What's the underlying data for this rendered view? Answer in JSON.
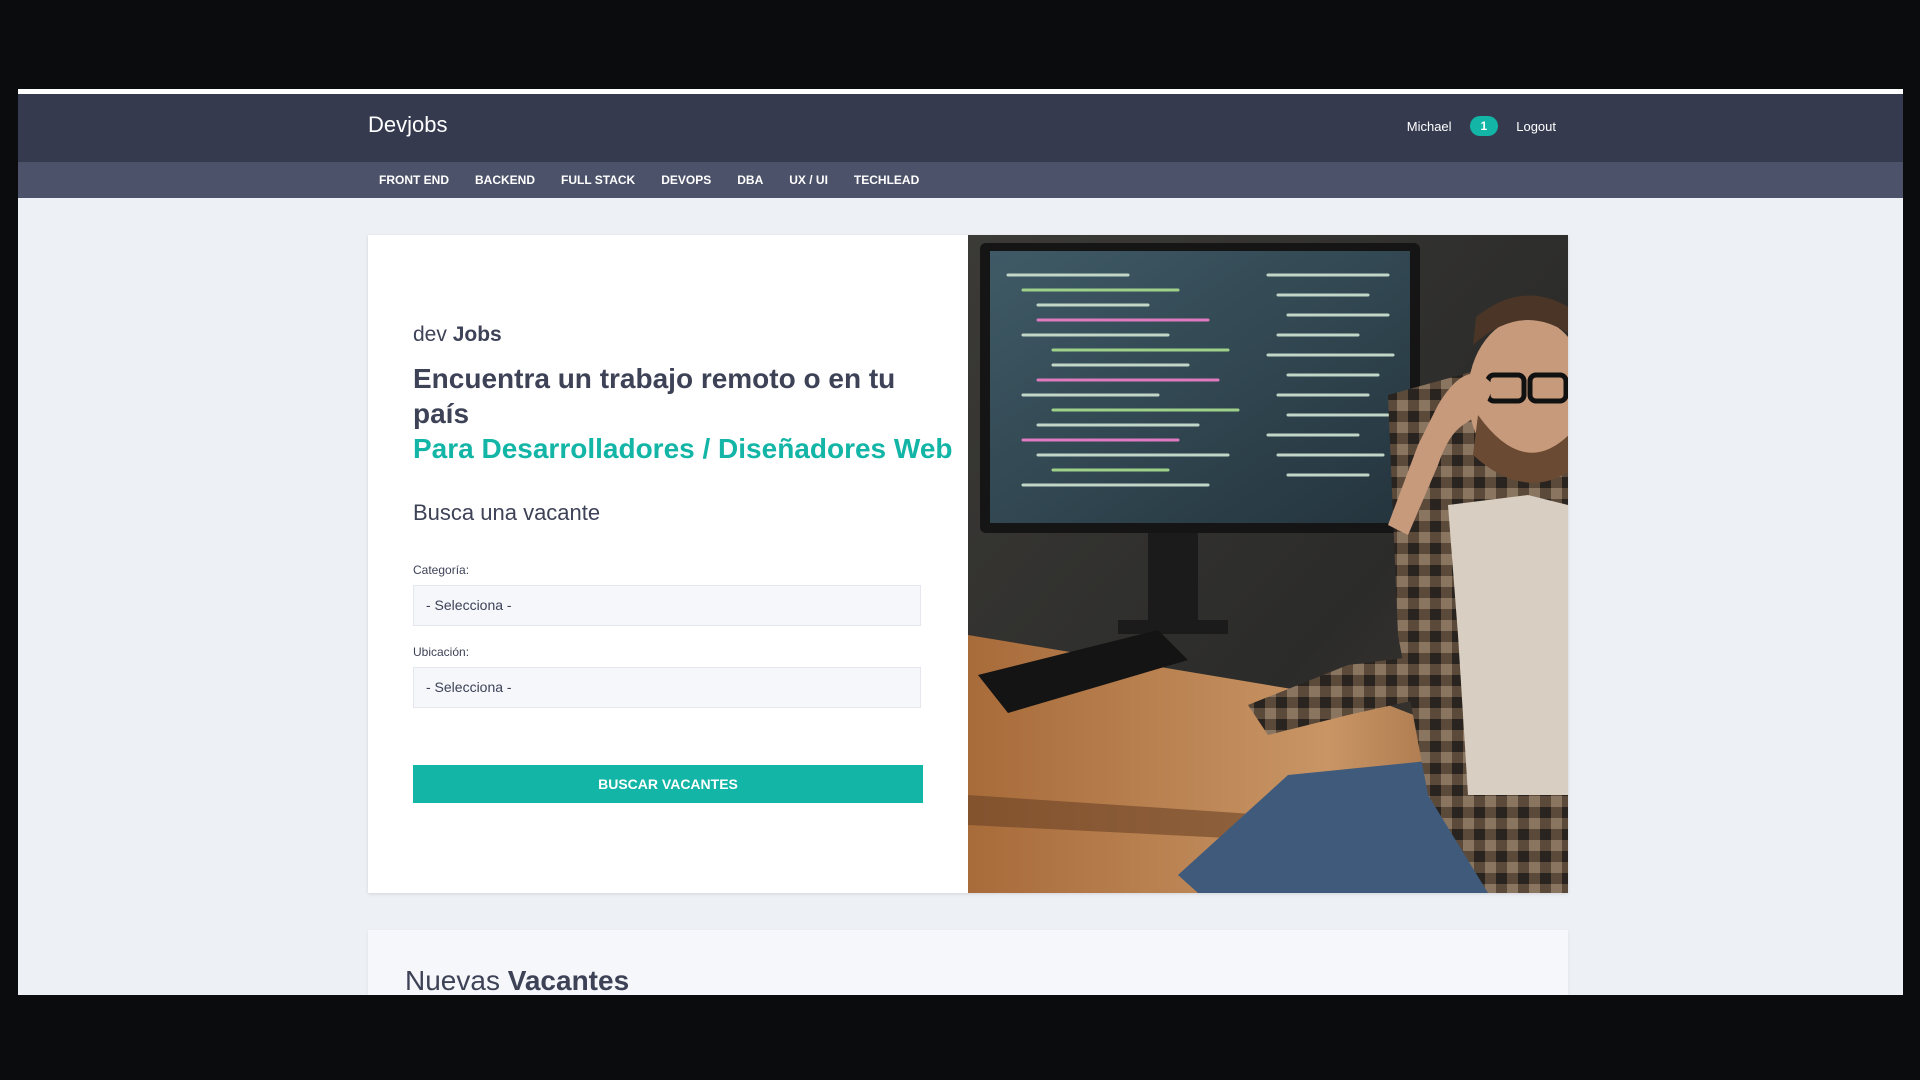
{
  "header": {
    "brand": "Devjobs",
    "username": "Michael",
    "badge_count": "1",
    "logout_label": "Logout"
  },
  "categories": [
    "FRONT END",
    "BACKEND",
    "FULL STACK",
    "DEVOPS",
    "DBA",
    "UX / UI",
    "TECHLEAD"
  ],
  "hero": {
    "kicker_prefix": "dev",
    "kicker_bold": "Jobs",
    "headline": "Encuentra un trabajo remoto o en tu país",
    "subheadline": "Para Desarrolladores / Diseñadores Web",
    "search_title": "Busca una vacante",
    "category_label": "Categoría:",
    "category_value": "- Selecciona -",
    "location_label": "Ubicación:",
    "location_value": "- Selecciona -",
    "button_label": "BUSCAR VACANTES"
  },
  "new_jobs": {
    "title_prefix": "Nuevas",
    "title_bold": "Vacantes"
  },
  "colors": {
    "accent": "#12b5a6",
    "header_bg": "#353a4f",
    "nav_bg": "#4c5269",
    "page_bg": "#edf0f5",
    "text_dark": "#3d4257"
  }
}
